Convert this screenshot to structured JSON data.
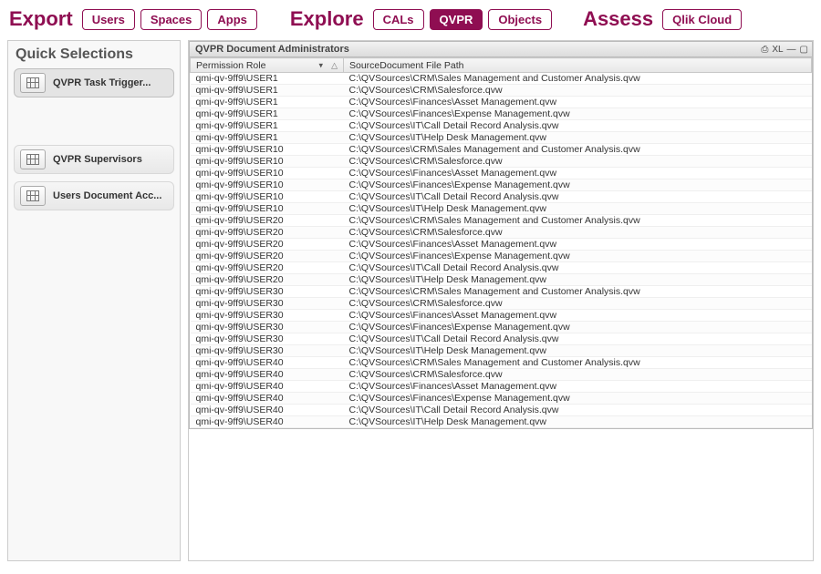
{
  "topbar": {
    "groups": [
      {
        "label": "Export",
        "items": [
          {
            "label": "Users",
            "active": false
          },
          {
            "label": "Spaces",
            "active": false
          },
          {
            "label": "Apps",
            "active": false
          }
        ]
      },
      {
        "label": "Explore",
        "items": [
          {
            "label": "CALs",
            "active": false
          },
          {
            "label": "QVPR",
            "active": true
          },
          {
            "label": "Objects",
            "active": false
          }
        ]
      },
      {
        "label": "Assess",
        "items": [
          {
            "label": "Qlik Cloud",
            "active": false
          }
        ]
      }
    ]
  },
  "quick_selections": {
    "title": "Quick Selections",
    "items": [
      {
        "label": "QVPR Task Trigger...",
        "selected": true,
        "gap_after": true
      },
      {
        "label": "QVPR Supervisors",
        "selected": false,
        "gap_after": false
      },
      {
        "label": "Users Document Acc...",
        "selected": false,
        "gap_after": false
      }
    ]
  },
  "table": {
    "title": "QVPR Document Administrators",
    "toolbar_xl": "XL",
    "columns": [
      "Permission Role",
      "SourceDocument File Path"
    ],
    "rows": [
      {
        "role": "qmi-qv-9ff9\\USER1",
        "path": "C:\\QVSources\\CRM\\Sales Management and Customer Analysis.qvw"
      },
      {
        "role": "qmi-qv-9ff9\\USER1",
        "path": "C:\\QVSources\\CRM\\Salesforce.qvw"
      },
      {
        "role": "qmi-qv-9ff9\\USER1",
        "path": "C:\\QVSources\\Finances\\Asset Management.qvw"
      },
      {
        "role": "qmi-qv-9ff9\\USER1",
        "path": "C:\\QVSources\\Finances\\Expense Management.qvw"
      },
      {
        "role": "qmi-qv-9ff9\\USER1",
        "path": "C:\\QVSources\\IT\\Call Detail Record Analysis.qvw"
      },
      {
        "role": "qmi-qv-9ff9\\USER1",
        "path": "C:\\QVSources\\IT\\Help Desk Management.qvw"
      },
      {
        "role": "qmi-qv-9ff9\\USER10",
        "path": "C:\\QVSources\\CRM\\Sales Management and Customer Analysis.qvw"
      },
      {
        "role": "qmi-qv-9ff9\\USER10",
        "path": "C:\\QVSources\\CRM\\Salesforce.qvw"
      },
      {
        "role": "qmi-qv-9ff9\\USER10",
        "path": "C:\\QVSources\\Finances\\Asset Management.qvw"
      },
      {
        "role": "qmi-qv-9ff9\\USER10",
        "path": "C:\\QVSources\\Finances\\Expense Management.qvw"
      },
      {
        "role": "qmi-qv-9ff9\\USER10",
        "path": "C:\\QVSources\\IT\\Call Detail Record Analysis.qvw"
      },
      {
        "role": "qmi-qv-9ff9\\USER10",
        "path": "C:\\QVSources\\IT\\Help Desk Management.qvw"
      },
      {
        "role": "qmi-qv-9ff9\\USER20",
        "path": "C:\\QVSources\\CRM\\Sales Management and Customer Analysis.qvw"
      },
      {
        "role": "qmi-qv-9ff9\\USER20",
        "path": "C:\\QVSources\\CRM\\Salesforce.qvw"
      },
      {
        "role": "qmi-qv-9ff9\\USER20",
        "path": "C:\\QVSources\\Finances\\Asset Management.qvw"
      },
      {
        "role": "qmi-qv-9ff9\\USER20",
        "path": "C:\\QVSources\\Finances\\Expense Management.qvw"
      },
      {
        "role": "qmi-qv-9ff9\\USER20",
        "path": "C:\\QVSources\\IT\\Call Detail Record Analysis.qvw"
      },
      {
        "role": "qmi-qv-9ff9\\USER20",
        "path": "C:\\QVSources\\IT\\Help Desk Management.qvw"
      },
      {
        "role": "qmi-qv-9ff9\\USER30",
        "path": "C:\\QVSources\\CRM\\Sales Management and Customer Analysis.qvw"
      },
      {
        "role": "qmi-qv-9ff9\\USER30",
        "path": "C:\\QVSources\\CRM\\Salesforce.qvw"
      },
      {
        "role": "qmi-qv-9ff9\\USER30",
        "path": "C:\\QVSources\\Finances\\Asset Management.qvw"
      },
      {
        "role": "qmi-qv-9ff9\\USER30",
        "path": "C:\\QVSources\\Finances\\Expense Management.qvw"
      },
      {
        "role": "qmi-qv-9ff9\\USER30",
        "path": "C:\\QVSources\\IT\\Call Detail Record Analysis.qvw"
      },
      {
        "role": "qmi-qv-9ff9\\USER30",
        "path": "C:\\QVSources\\IT\\Help Desk Management.qvw"
      },
      {
        "role": "qmi-qv-9ff9\\USER40",
        "path": "C:\\QVSources\\CRM\\Sales Management and Customer Analysis.qvw"
      },
      {
        "role": "qmi-qv-9ff9\\USER40",
        "path": "C:\\QVSources\\CRM\\Salesforce.qvw"
      },
      {
        "role": "qmi-qv-9ff9\\USER40",
        "path": "C:\\QVSources\\Finances\\Asset Management.qvw"
      },
      {
        "role": "qmi-qv-9ff9\\USER40",
        "path": "C:\\QVSources\\Finances\\Expense Management.qvw"
      },
      {
        "role": "qmi-qv-9ff9\\USER40",
        "path": "C:\\QVSources\\IT\\Call Detail Record Analysis.qvw"
      },
      {
        "role": "qmi-qv-9ff9\\USER40",
        "path": "C:\\QVSources\\IT\\Help Desk Management.qvw"
      }
    ]
  }
}
